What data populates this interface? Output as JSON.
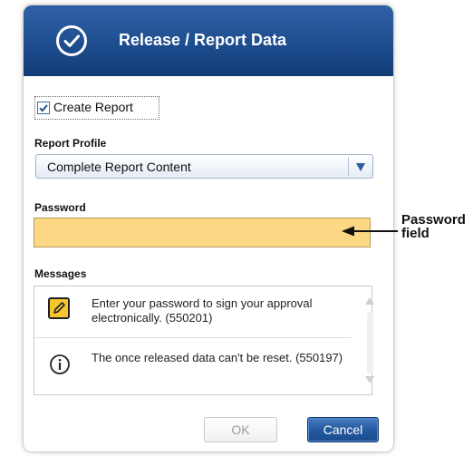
{
  "dialog": {
    "title": "Release / Report Data",
    "title_icon": "checkmark-circle-icon",
    "create_report": {
      "label": "Create Report",
      "checked": true
    },
    "report_profile": {
      "label": "Report Profile",
      "selected": "Complete Report Content"
    },
    "password": {
      "label": "Password",
      "value": ""
    },
    "messages": {
      "label": "Messages",
      "items": [
        {
          "icon": "edit-pencil-icon",
          "text": "Enter your password to sign your approval electronically. (550201)"
        },
        {
          "icon": "info-icon",
          "text": "The once released data can't be reset. (550197)"
        }
      ]
    },
    "ok_label": "OK",
    "cancel_label": "Cancel"
  },
  "annotation": {
    "line1": "Password",
    "line2": "field"
  },
  "colors": {
    "title_bar": "#1e4d8f",
    "password_highlight": "#fcd885",
    "primary_button": "#245aa0"
  }
}
